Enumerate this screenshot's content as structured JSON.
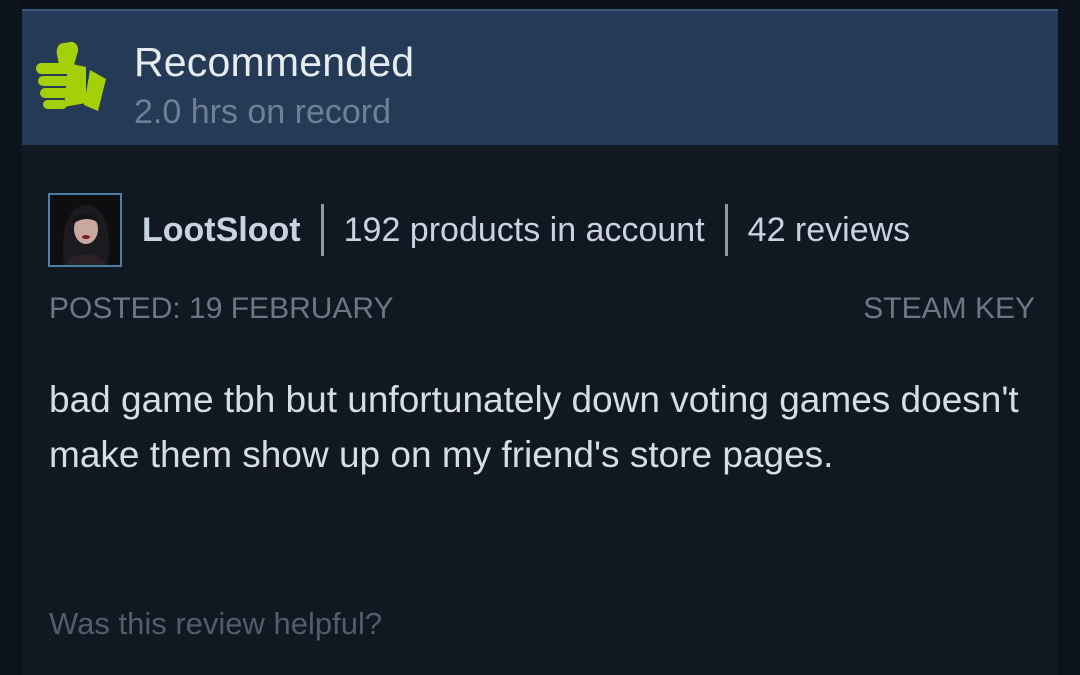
{
  "review": {
    "verdict": "Recommended",
    "hours": "2.0 hrs on record",
    "verdict_icon": "thumbs-up-icon",
    "accent_color": "#a4d007"
  },
  "author": {
    "name": "LootSloot",
    "products": "192 products in account",
    "reviews": "42 reviews"
  },
  "meta": {
    "posted": "POSTED: 19 FEBRUARY",
    "key_type": "STEAM KEY"
  },
  "body": {
    "text": "bad game tbh but unfortunately down voting games doesn't make them show up on my friend's store pages."
  },
  "footer": {
    "helpful_prompt": "Was this review helpful?"
  }
}
